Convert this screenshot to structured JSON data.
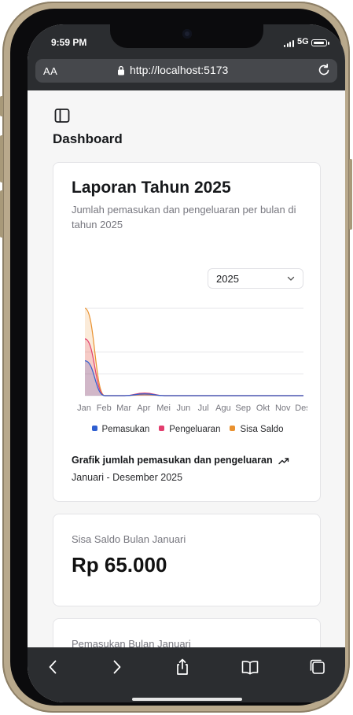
{
  "status_bar": {
    "time": "9:59 PM",
    "network": "5G"
  },
  "browser": {
    "text_size_label": "AA",
    "url": "http://localhost:5173"
  },
  "page": {
    "title": "Dashboard"
  },
  "report_card": {
    "title": "Laporan Tahun 2025",
    "description": "Jumlah pemasukan dan pengeluaran per bulan di tahun 2025",
    "year_select": {
      "value": "2025"
    },
    "footer_title": "Grafik jumlah pemasukan dan pengeluaran",
    "footer_subtitle": "Januari - Desember 2025"
  },
  "chart_data": {
    "type": "area",
    "categories": [
      "Jan",
      "Feb",
      "Mar",
      "Apr",
      "Mei",
      "Jun",
      "Jul",
      "Agu",
      "Sep",
      "Okt",
      "Nov",
      "Des"
    ],
    "series": [
      {
        "name": "Pemasukan",
        "color": "#2f5fd0",
        "values": [
          40,
          0,
          0,
          2,
          0,
          0,
          0,
          0,
          0,
          0,
          0,
          0
        ]
      },
      {
        "name": "Pengeluaran",
        "color": "#e23d6e",
        "values": [
          65,
          0,
          0,
          3,
          0,
          0,
          0,
          0,
          0,
          0,
          0,
          0
        ]
      },
      {
        "name": "Sisa Saldo",
        "color": "#e9912f",
        "values": [
          100,
          0,
          0,
          1,
          0,
          0,
          0,
          0,
          0,
          0,
          0,
          0
        ]
      }
    ],
    "ylim": [
      0,
      100
    ],
    "grid": true,
    "legend": "bottom"
  },
  "balance_card": {
    "label": "Sisa Saldo Bulan Januari",
    "value": "Rp 65.000"
  },
  "income_card": {
    "label": "Pemasukan Bulan Januari"
  },
  "colors": {
    "background": "#f6f6f6",
    "card": "#ffffff",
    "browser_chrome": "#2b2d30"
  }
}
